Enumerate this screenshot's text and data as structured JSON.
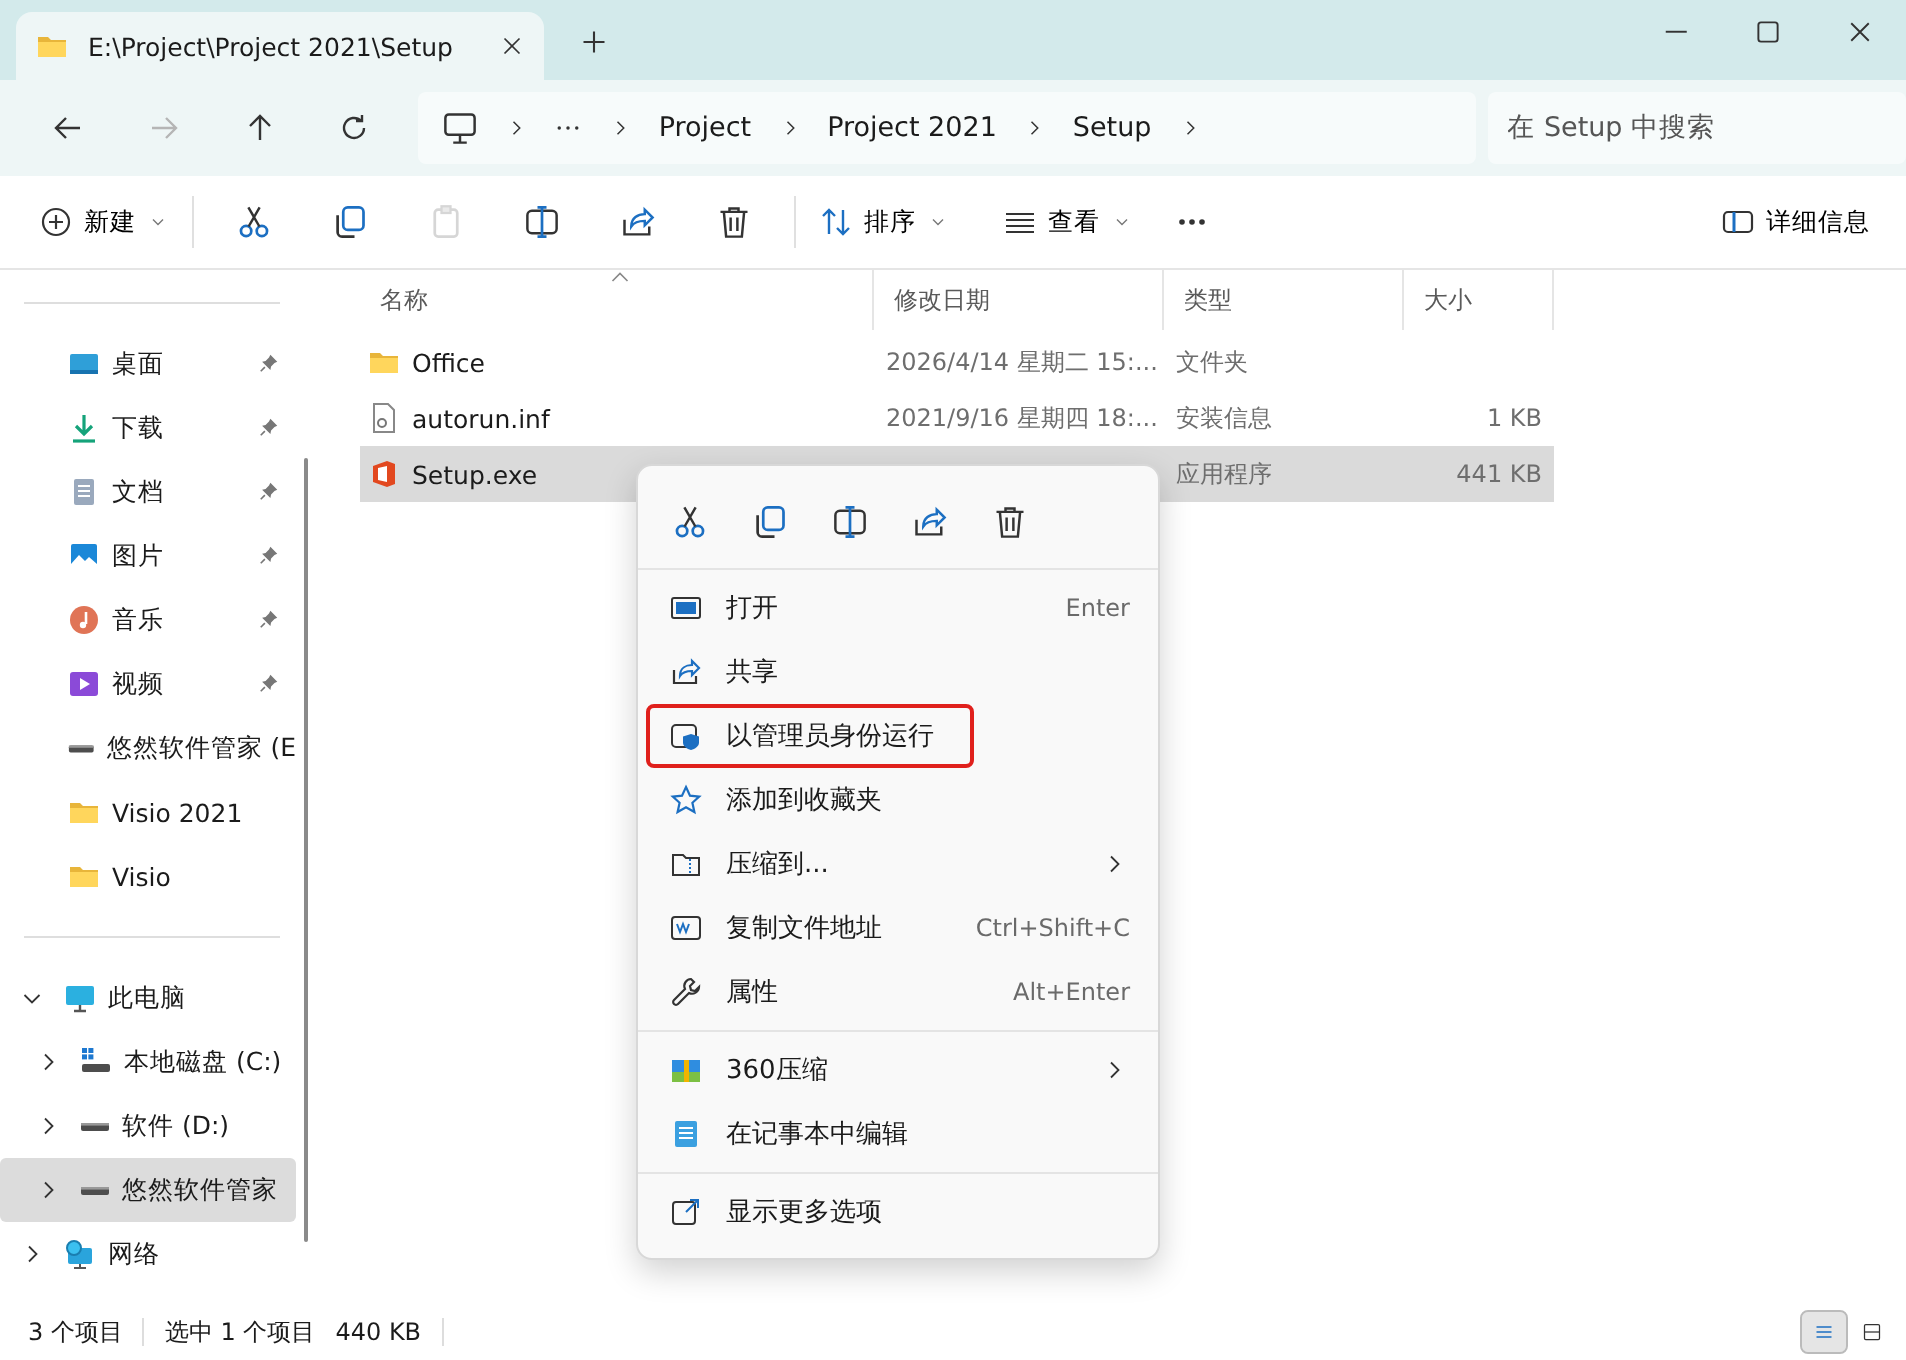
{
  "window": {
    "tab_title": "E:\\Project\\Project 2021\\Setup"
  },
  "address": {
    "crumbs": [
      "Project",
      "Project 2021",
      "Setup"
    ],
    "search_placeholder": "在 Setup 中搜索"
  },
  "toolbar": {
    "new_label": "新建",
    "actions": [
      {
        "disabled": false
      },
      {
        "disabled": false
      },
      {
        "disabled": true
      },
      {
        "disabled": false
      },
      {
        "disabled": false
      },
      {
        "disabled": false
      }
    ],
    "sort_label": "排序",
    "view_label": "查看",
    "details_label": "详细信息"
  },
  "sidebar": {
    "quick": [
      {
        "label": "桌面",
        "pinned": true
      },
      {
        "label": "下载",
        "pinned": true
      },
      {
        "label": "文档",
        "pinned": true
      },
      {
        "label": "图片",
        "pinned": true
      },
      {
        "label": "音乐",
        "pinned": true
      },
      {
        "label": "视频",
        "pinned": true
      },
      {
        "label": "悠然软件管家 (E",
        "pinned": false
      },
      {
        "label": "Visio 2021",
        "pinned": false
      },
      {
        "label": "Visio",
        "pinned": false
      }
    ],
    "tree": [
      {
        "label": "此电脑",
        "expanded": true,
        "selected": false,
        "children": [
          {
            "label": "本地磁盘 (C:)",
            "expanded": false,
            "selected": false
          },
          {
            "label": "软件 (D:)",
            "expanded": false,
            "selected": false
          },
          {
            "label": "悠然软件管家",
            "expanded": false,
            "selected": true
          }
        ]
      },
      {
        "label": "网络",
        "expanded": false,
        "selected": false
      }
    ]
  },
  "table": {
    "columns": [
      "名称",
      "修改日期",
      "类型",
      "大小"
    ],
    "rows": [
      {
        "name": "Office",
        "date": "2026/4/14 星期二 15:...",
        "type": "文件夹",
        "selected": false
      },
      {
        "name": "autorun.inf",
        "date": "2021/9/16 星期四 18:...",
        "type": "安装信息",
        "size": "1 KB",
        "selected": false
      },
      {
        "name": "Setup.exe",
        "type": "应用程序",
        "size": "441 KB",
        "selected": true
      }
    ]
  },
  "context_menu": {
    "groups": [
      {
        "items": [
          {
            "label": "打开",
            "shortcut": "Enter",
            "submenu": false,
            "highlighted": false
          },
          {
            "label": "共享",
            "submenu": false,
            "highlighted": false
          },
          {
            "label": "以管理员身份运行",
            "submenu": false,
            "highlighted": true
          },
          {
            "label": "添加到收藏夹",
            "submenu": false,
            "highlighted": false
          },
          {
            "label": "压缩到...",
            "submenu": true,
            "highlighted": false
          },
          {
            "label": "复制文件地址",
            "shortcut": "Ctrl+Shift+C",
            "submenu": false,
            "highlighted": false
          },
          {
            "label": "属性",
            "shortcut": "Alt+Enter",
            "submenu": false,
            "highlighted": false
          }
        ]
      },
      {
        "items": [
          {
            "label": "360压缩",
            "submenu": true,
            "highlighted": false
          },
          {
            "label": "在记事本中编辑",
            "submenu": false,
            "highlighted": false
          }
        ]
      },
      {
        "items": [
          {
            "label": "显示更多选项",
            "submenu": false,
            "highlighted": false
          }
        ]
      }
    ]
  },
  "status_bar": {
    "count": "3 个项目",
    "selection": "选中 1 个项目",
    "size": "440 KB",
    "views": [
      {
        "selected": true
      },
      {
        "selected": false
      }
    ]
  }
}
